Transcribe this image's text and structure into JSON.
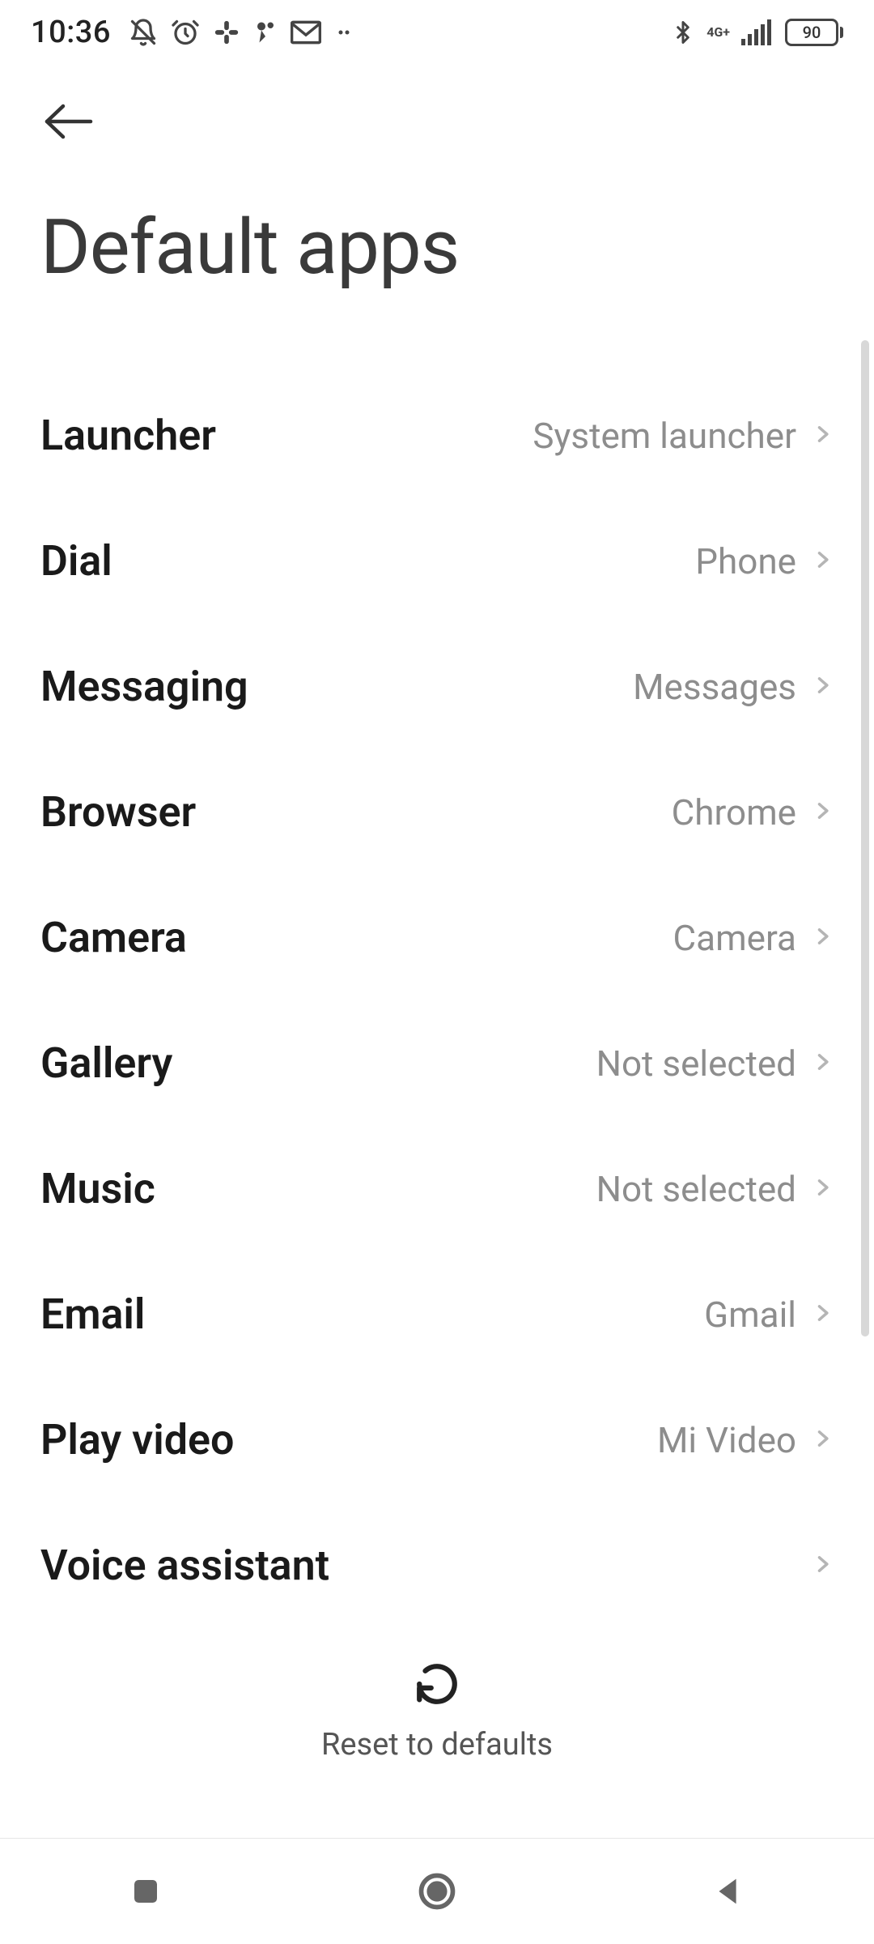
{
  "status": {
    "time": "10:36",
    "network_label": "4G+",
    "battery_level": "90"
  },
  "header": {
    "title": "Default apps"
  },
  "list": [
    {
      "label": "Launcher",
      "value": "System launcher"
    },
    {
      "label": "Dial",
      "value": "Phone"
    },
    {
      "label": "Messaging",
      "value": "Messages"
    },
    {
      "label": "Browser",
      "value": "Chrome"
    },
    {
      "label": "Camera",
      "value": "Camera"
    },
    {
      "label": "Gallery",
      "value": "Not selected"
    },
    {
      "label": "Music",
      "value": "Not selected"
    },
    {
      "label": "Email",
      "value": "Gmail"
    },
    {
      "label": "Play video",
      "value": "Mi Video"
    },
    {
      "label": "Voice assistant",
      "value": ""
    }
  ],
  "reset": {
    "label": "Reset to defaults"
  }
}
